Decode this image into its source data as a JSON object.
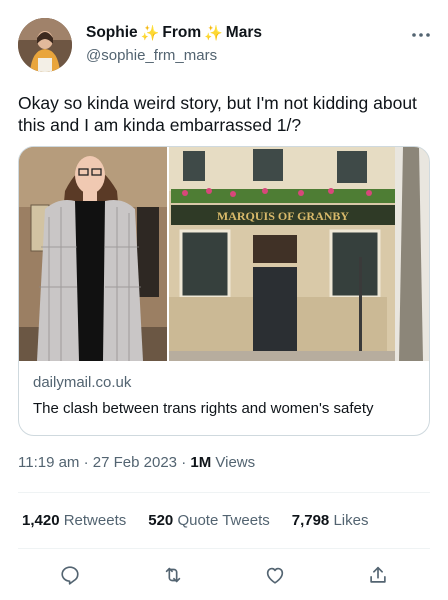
{
  "tweet": {
    "author_name_part1": "Sophie",
    "author_name_part2": "From",
    "author_name_part3": "Mars",
    "sparkle_glyph": "✨",
    "handle": "@sophie_frm_mars",
    "more_icon": "more-horizontal-icon",
    "text": "Okay so kinda weird story, but I'm not kidding about this and I am kinda embarrassed 1/?"
  },
  "card": {
    "sign_text": "MARQUIS OF GRANBY",
    "domain": "dailymail.co.uk",
    "title": "The clash between trans rights and women's safety"
  },
  "meta": {
    "time": "11:19 am",
    "date": "27 Feb 2023",
    "separator": "·",
    "views_count": "1M",
    "views_label": "Views"
  },
  "stats": {
    "retweets_count": "1,420",
    "retweets_label": "Retweets",
    "quotes_count": "520",
    "quotes_label": "Quote Tweets",
    "likes_count": "7,798",
    "likes_label": "Likes"
  },
  "actions": [
    "reply-icon",
    "retweet-icon",
    "like-icon",
    "share-icon"
  ],
  "colors": {
    "text_primary": "#0f1419",
    "text_secondary": "#536471",
    "border": "#cfd9de",
    "sparkle": "#f5b400"
  }
}
